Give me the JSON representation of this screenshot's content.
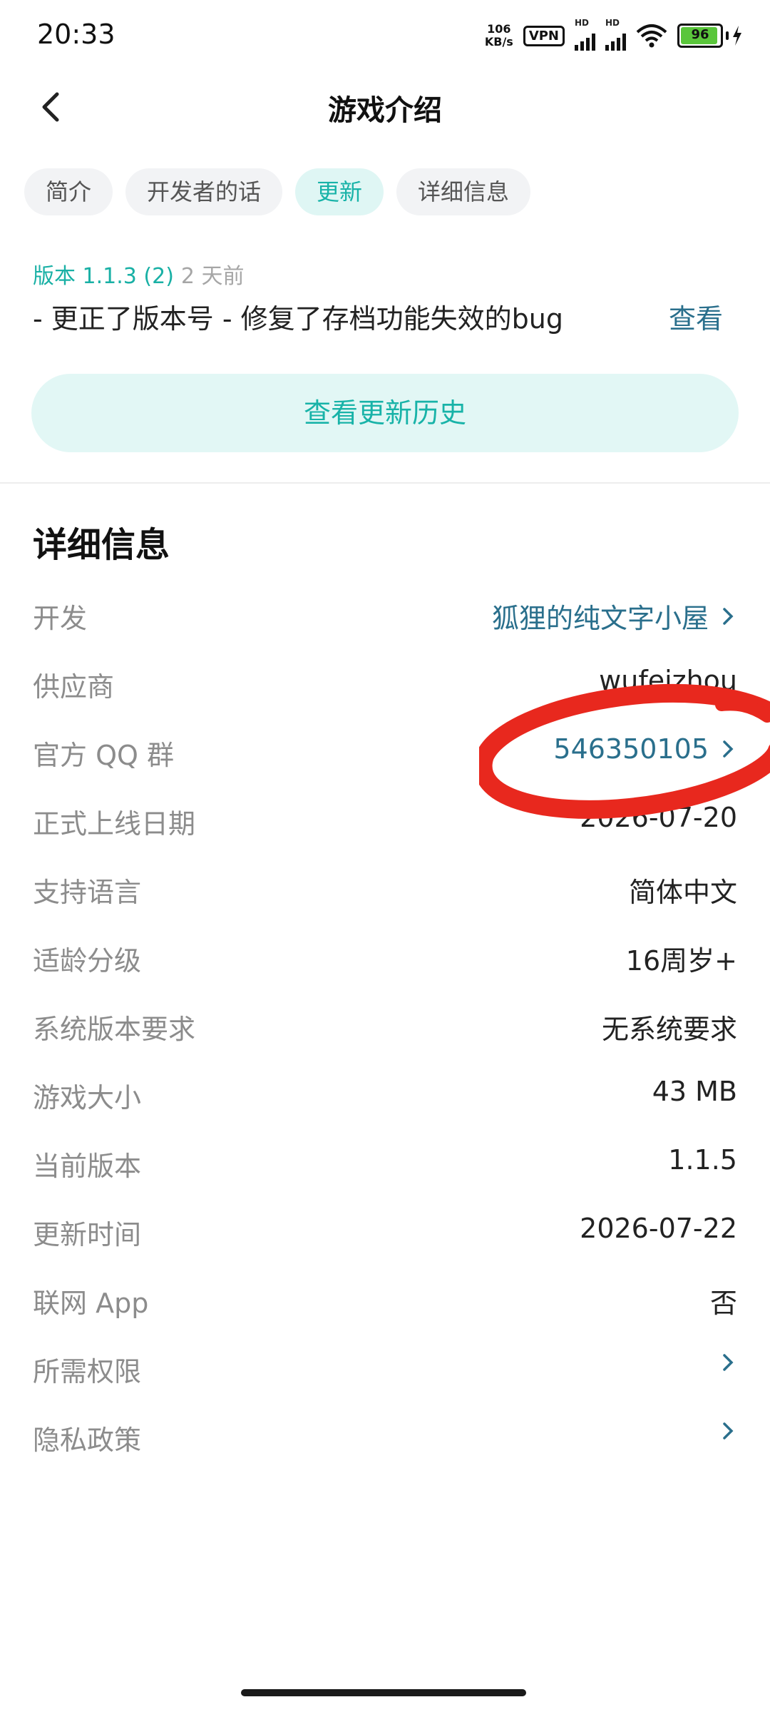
{
  "status_bar": {
    "time": "20:33",
    "net_speed_value": "106",
    "net_speed_unit": "KB/s",
    "vpn_label": "VPN",
    "signal1_label": "HD",
    "signal2_label": "HD",
    "battery_level": "96",
    "battery_color": "#5ac63b"
  },
  "header": {
    "title": "游戏介绍",
    "back_icon": "chevron-left-icon"
  },
  "tabs": [
    {
      "label": "简介"
    },
    {
      "label": "开发者的话"
    },
    {
      "label": "更新",
      "active": true
    },
    {
      "label": "详细信息"
    }
  ],
  "update": {
    "version": "版本 1.1.3 (2)",
    "time_ago": "2 天前",
    "changelog": "- 更正了版本号 - 修复了存档功能失效的bug",
    "view_label": "查看",
    "history_button": "查看更新历史"
  },
  "details": {
    "title": "详细信息",
    "rows": [
      {
        "label": "开发",
        "value": "狐狸的纯文字小屋",
        "link": true
      },
      {
        "label": "供应商",
        "value": "wufeizhou"
      },
      {
        "label": "官方 QQ 群",
        "value": "546350105",
        "link": true
      },
      {
        "label": "正式上线日期",
        "value": "2026-07-20"
      },
      {
        "label": "支持语言",
        "value": "简体中文"
      },
      {
        "label": "适龄分级",
        "value": "16周岁+"
      },
      {
        "label": "系统版本要求",
        "value": "无系统要求"
      },
      {
        "label": "游戏大小",
        "value": "43 MB"
      },
      {
        "label": "当前版本",
        "value": "1.1.5"
      },
      {
        "label": "更新时间",
        "value": "2026-07-22"
      },
      {
        "label": "联网 App",
        "value": "否"
      },
      {
        "label": "所需权限",
        "value": "",
        "link": true
      },
      {
        "label": "隐私政策",
        "value": "",
        "link": true
      }
    ]
  },
  "colors": {
    "accent": "#18b3a8",
    "link": "#2a6f8c",
    "annotation": "#e8281e"
  }
}
